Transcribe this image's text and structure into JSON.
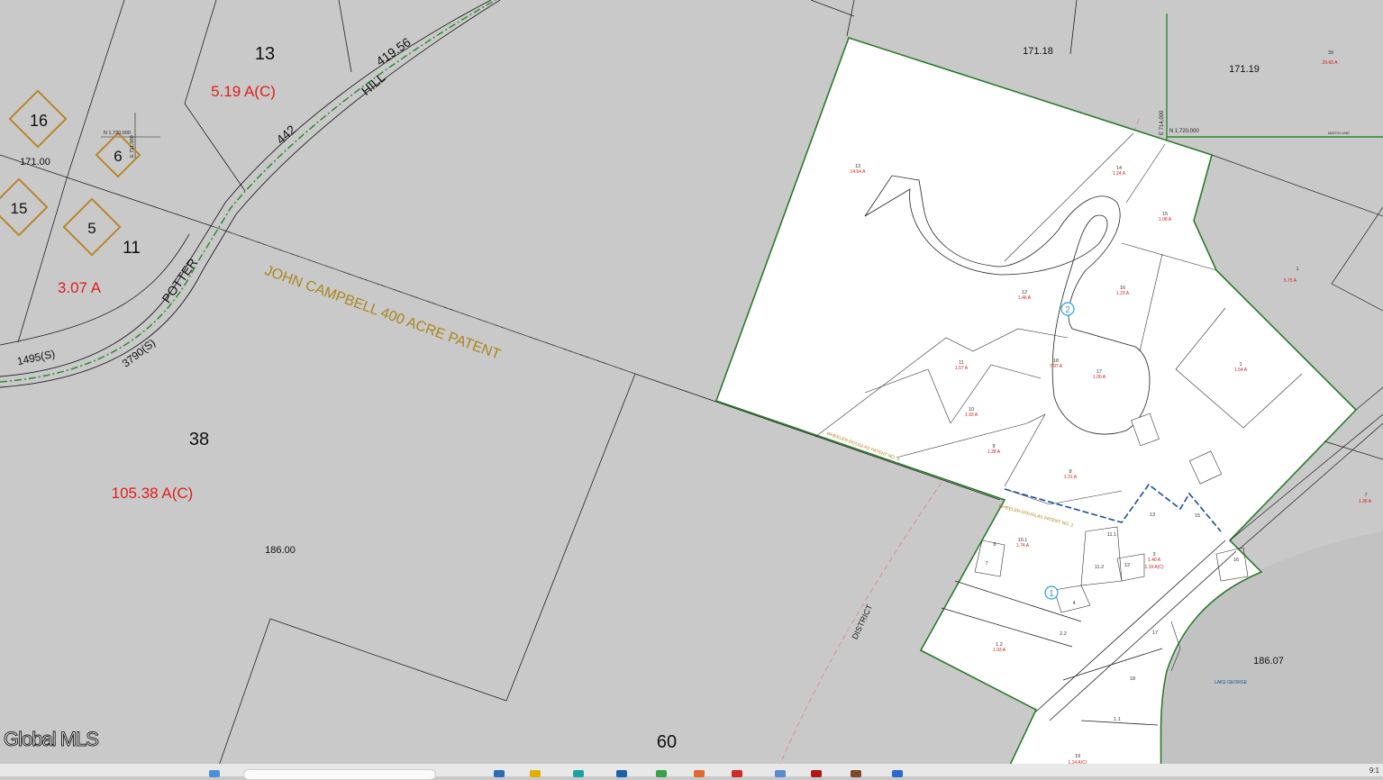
{
  "colors": {
    "background": "#c9c9c9",
    "parcel_line": "#222222",
    "subdivision_boundary": "#1f7a1f",
    "road_centerline": "#2e8b2e",
    "acreage_text": "#e0201a",
    "patent_text": "#a8861c",
    "district_line": "#e07a7a",
    "patent_boundary_blue": "#1a4fa0",
    "lake_fill": "#c2c2c2",
    "map_marker": "#2aa0d8",
    "diamond": "#b8862a"
  },
  "watermark": "Global MLS",
  "clock": "9:1",
  "parcels": {
    "p13": {
      "number": "13",
      "acreage": "5.19 A(C)"
    },
    "p11": {
      "number": "11",
      "acreage": "3.07 A"
    },
    "p38": {
      "number": "38",
      "acreage": "105.38 A(C)"
    },
    "p60": {
      "number": "60"
    },
    "p13_sub": {
      "number": "13",
      "acreage": "14.64 A"
    },
    "p14_sub": {
      "number": "14",
      "acreage": "1.24 A"
    },
    "p15_sub": {
      "number": "15",
      "acreage": "1.08 A"
    },
    "p16_sub": {
      "number": "16",
      "acreage": "1.23 A"
    },
    "p12_sub": {
      "number": "12",
      "acreage": "1.46 A"
    },
    "p11_sub": {
      "number": "11",
      "acreage": "1.57 A"
    },
    "p18_sub": {
      "number": "18",
      "acreage": "7.97 A"
    },
    "p17_sub": {
      "number": "17",
      "acreage": "1.00 A"
    },
    "p1_sub": {
      "number": "1",
      "acreage": "1.54 A"
    },
    "p10_sub": {
      "number": "10",
      "acreage": "1.93 A"
    },
    "p9_sub": {
      "number": "9",
      "acreage": "1.28 A"
    },
    "p8_sub": {
      "number": "8",
      "acreage": "1.21 A"
    },
    "p10_1": {
      "number": "10.1",
      "acreage": "1.74 A"
    },
    "p3": {
      "number": "3",
      "acreage": "1.40 A",
      "acreage2": "1.19 A(C)"
    },
    "p1_2": {
      "number": "1.2",
      "acreage": "1.93 A"
    },
    "p39": {
      "number": "39",
      "acreage": "29.60 A"
    },
    "p1_right": {
      "number": "1",
      "acreage": "5.75 A"
    },
    "p7_right": {
      "number": "7",
      "acreage": "1.36 A"
    },
    "p19": {
      "number": "19",
      "acreage": "1.14 A(C)"
    }
  },
  "section_labels": {
    "s171_00": "171.00",
    "s186_00": "186.00",
    "s171_18": "171.18",
    "s171_19": "171.19",
    "s186_07": "186.07"
  },
  "diamonds": [
    "16",
    "6",
    "15",
    "5"
  ],
  "road_labels": {
    "hill": "HILL",
    "potter": "POTTER",
    "len_419": "419.56",
    "len_442": "442",
    "len_1495": "1495(S)",
    "len_3790": "3790(S)"
  },
  "patent_label": "JOHN CAMPBELL 400 ACRE PATENT",
  "district_label": "DISTRICT",
  "lake_label": "LAKE GEORGE",
  "wheeler_label_1": "WHEELER-DOUGLAS PATENT NO. 3",
  "wheeler_label_2": "WHEELER-DOUGLAS PATENT NO. 2",
  "grid": {
    "n_1720000_left": "N 1,720,000",
    "e_711000": "E 711,000",
    "n_1720000_right": "N 1,720,000",
    "e_714000": "E 714,000",
    "match_line": "MATCH LINE"
  },
  "markers": [
    "1",
    "2"
  ],
  "small_lots": {
    "l14": "14",
    "l15": "15",
    "l16": "16",
    "l17": "17",
    "l18": "18",
    "l13": "13",
    "l11_1": "11.1",
    "l11_2": "11.2",
    "l12": "12",
    "l8": "8",
    "l7": "7",
    "l4": "4",
    "l2_2": "2.2",
    "l1_1": "1.1",
    "l6": "6"
  }
}
